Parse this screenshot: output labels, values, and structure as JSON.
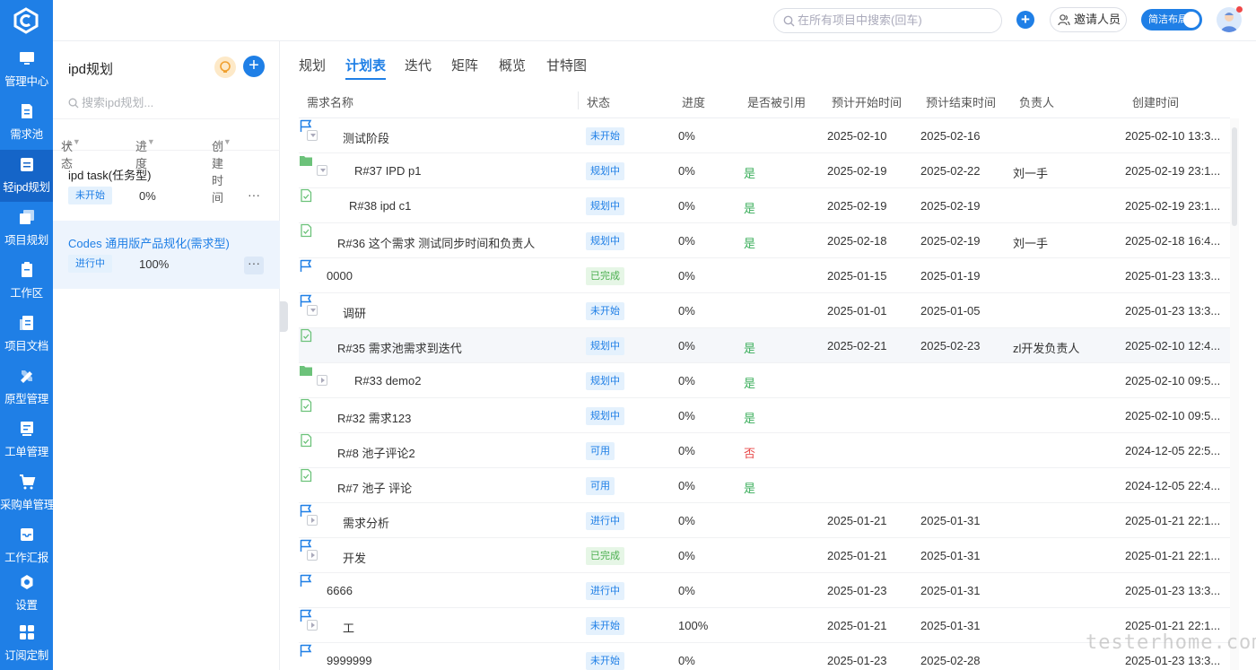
{
  "nav": {
    "items": [
      {
        "label": "管理中心"
      },
      {
        "label": "需求池"
      },
      {
        "label": "轻ipd规划"
      },
      {
        "label": "项目规划"
      },
      {
        "label": "工作区"
      },
      {
        "label": "项目文档"
      },
      {
        "label": "原型管理"
      },
      {
        "label": "工单管理"
      },
      {
        "label": "采购单管理"
      },
      {
        "label": "工作汇报"
      },
      {
        "label": "设置"
      },
      {
        "label": "订阅定制"
      }
    ]
  },
  "topbar": {
    "search_placeholder": "在所有项目中搜索(回车)",
    "invite_label": "邀请人员",
    "toggle_label": "简洁布局"
  },
  "panel": {
    "title": "ipd规划",
    "search_placeholder": "搜索ipd规划...",
    "sorts": [
      "状态",
      "进度",
      "创建时间"
    ],
    "projects": [
      {
        "name": "ipd task(任务型)",
        "status": "未开始",
        "progress": "0%"
      },
      {
        "name": "Codes 通用版产品规化(需求型)",
        "status": "进行中",
        "progress": "100%"
      }
    ]
  },
  "tabs": [
    "规划",
    "计划表",
    "迭代",
    "矩阵",
    "概览",
    "甘特图"
  ],
  "table": {
    "headers": [
      "需求名称",
      "状态",
      "进度",
      "是否被引用",
      "预计开始时间",
      "预计结束时间",
      "负责人",
      "创建时间"
    ],
    "rows": [
      {
        "name": "测试阶段",
        "status": "未开始",
        "progress": "0%",
        "ref": "",
        "start": "2025-02-10",
        "end": "2025-02-16",
        "owner": "",
        "created": "2025-02-10 13:3..."
      },
      {
        "name": "R#37 IPD p1",
        "status": "规划中",
        "progress": "0%",
        "ref": "是",
        "start": "2025-02-19",
        "end": "2025-02-22",
        "owner": "刘一手",
        "created": "2025-02-19 23:1..."
      },
      {
        "name": "R#38 ipd c1",
        "status": "规划中",
        "progress": "0%",
        "ref": "是",
        "start": "2025-02-19",
        "end": "2025-02-19",
        "owner": "",
        "created": "2025-02-19 23:1..."
      },
      {
        "name": "R#36 这个需求 测试同步时间和负责人",
        "status": "规划中",
        "progress": "0%",
        "ref": "是",
        "start": "2025-02-18",
        "end": "2025-02-19",
        "owner": "刘一手",
        "created": "2025-02-18 16:4..."
      },
      {
        "name": "0000",
        "status": "已完成",
        "progress": "0%",
        "ref": "",
        "start": "2025-01-15",
        "end": "2025-01-19",
        "owner": "",
        "created": "2025-01-23 13:3..."
      },
      {
        "name": "调研",
        "status": "未开始",
        "progress": "0%",
        "ref": "",
        "start": "2025-01-01",
        "end": "2025-01-05",
        "owner": "",
        "created": "2025-01-23 13:3..."
      },
      {
        "name": "R#35 需求池需求到迭代",
        "status": "规划中",
        "progress": "0%",
        "ref": "是",
        "start": "2025-02-21",
        "end": "2025-02-23",
        "owner": "zl开发负责人",
        "created": "2025-02-10 12:4..."
      },
      {
        "name": "R#33 demo2",
        "status": "规划中",
        "progress": "0%",
        "ref": "是",
        "start": "",
        "end": "",
        "owner": "",
        "created": "2025-02-10 09:5..."
      },
      {
        "name": "R#32 需求123",
        "status": "规划中",
        "progress": "0%",
        "ref": "是",
        "start": "",
        "end": "",
        "owner": "",
        "created": "2025-02-10 09:5..."
      },
      {
        "name": "R#8 池子评论2",
        "status": "可用",
        "progress": "0%",
        "ref": "否",
        "start": "",
        "end": "",
        "owner": "",
        "created": "2024-12-05 22:5..."
      },
      {
        "name": "R#7 池子 评论",
        "status": "可用",
        "progress": "0%",
        "ref": "是",
        "start": "",
        "end": "",
        "owner": "",
        "created": "2024-12-05 22:4..."
      },
      {
        "name": "需求分析",
        "status": "进行中",
        "progress": "0%",
        "ref": "",
        "start": "2025-01-21",
        "end": "2025-01-31",
        "owner": "",
        "created": "2025-01-21 22:1..."
      },
      {
        "name": "开发",
        "status": "已完成",
        "progress": "0%",
        "ref": "",
        "start": "2025-01-21",
        "end": "2025-01-31",
        "owner": "",
        "created": "2025-01-21 22:1..."
      },
      {
        "name": "6666",
        "status": "进行中",
        "progress": "0%",
        "ref": "",
        "start": "2025-01-23",
        "end": "2025-01-31",
        "owner": "",
        "created": "2025-01-23 13:3..."
      },
      {
        "name": "工",
        "status": "未开始",
        "progress": "100%",
        "ref": "",
        "start": "2025-01-21",
        "end": "2025-01-31",
        "owner": "",
        "created": "2025-01-21 22:1..."
      },
      {
        "name": "9999999",
        "status": "未开始",
        "progress": "0%",
        "ref": "",
        "start": "2025-01-23",
        "end": "2025-02-28",
        "owner": "",
        "created": "2025-01-23 13:3..."
      }
    ]
  },
  "watermark": "testerhome.com",
  "colors": {
    "accent": "#1f7fe6",
    "success": "#4caf50",
    "danger": "#e84a4a"
  }
}
